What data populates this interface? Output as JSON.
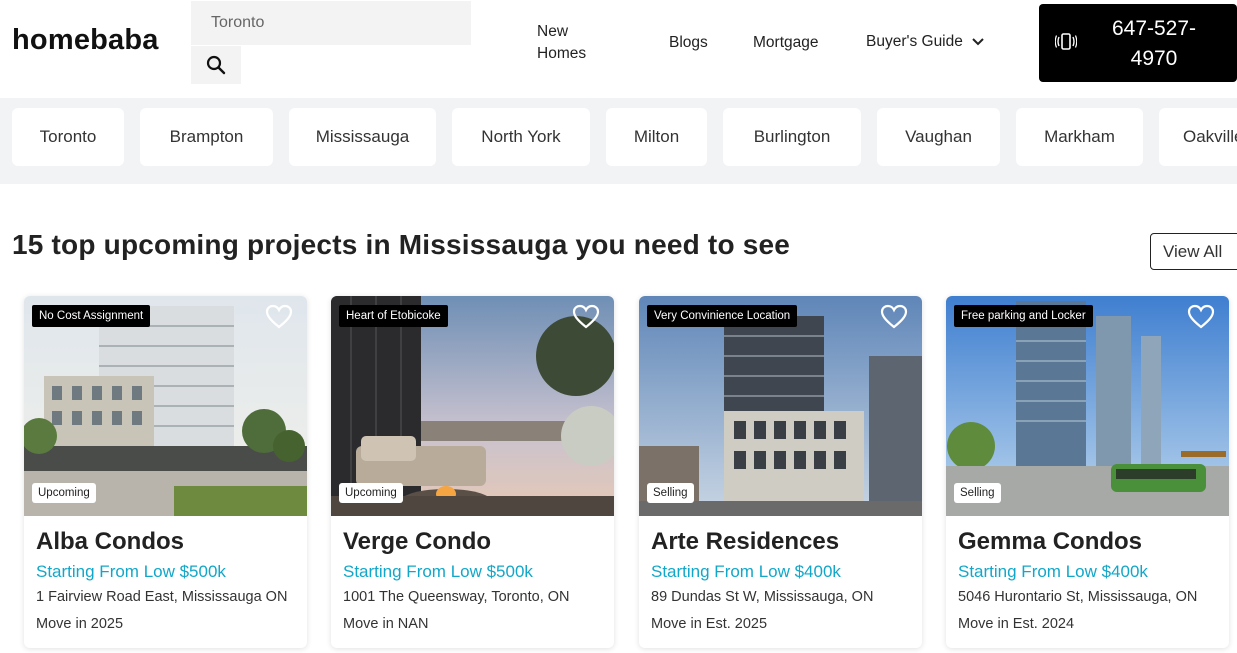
{
  "header": {
    "logo": "homebaba",
    "search_placeholder": "Toronto",
    "nav": {
      "new_homes": "New Homes",
      "blogs": "Blogs",
      "mortgage": "Mortgage",
      "buyers_guide": "Buyer's Guide"
    },
    "phone": "647-527-4970"
  },
  "cities": [
    "Toronto",
    "Brampton",
    "Mississauga",
    "North York",
    "Milton",
    "Burlington",
    "Vaughan",
    "Markham",
    "Oakville"
  ],
  "section": {
    "title": "15 top upcoming projects in Mississauga you need to see",
    "view_all": "View All"
  },
  "cards": [
    {
      "tag": "No Cost Assignment",
      "status": "Upcoming",
      "title": "Alba Condos",
      "price": "Starting From Low $500k",
      "address": "1 Fairview Road East, Mississauga ON",
      "move_in": "Move in 2025"
    },
    {
      "tag": "Heart of Etobicoke",
      "status": "Upcoming",
      "title": "Verge Condo",
      "price": "Starting From Low $500k",
      "address": "1001 The Queensway, Toronto, ON",
      "move_in": "Move in NAN"
    },
    {
      "tag": "Very Convinience Location",
      "status": "Selling",
      "title": "Arte Residences",
      "price": "Starting From Low $400k",
      "address": "89 Dundas St W, Mississauga, ON",
      "move_in": "Move in Est. 2025"
    },
    {
      "tag": "Free parking and Locker",
      "status": "Selling",
      "title": "Gemma Condos",
      "price": "Starting From Low $400k",
      "address": "5046 Hurontario St, Mississauga, ON",
      "move_in": "Move in Est. 2024"
    }
  ],
  "icons": {
    "search": "search-icon",
    "chevron": "chevron-down-icon",
    "phone": "phone-vibrate-icon",
    "heart": "heart-outline-icon"
  },
  "colors": {
    "price": "#12a7c9",
    "phone_bg": "#000000",
    "strip_bg": "#f2f3f5"
  }
}
